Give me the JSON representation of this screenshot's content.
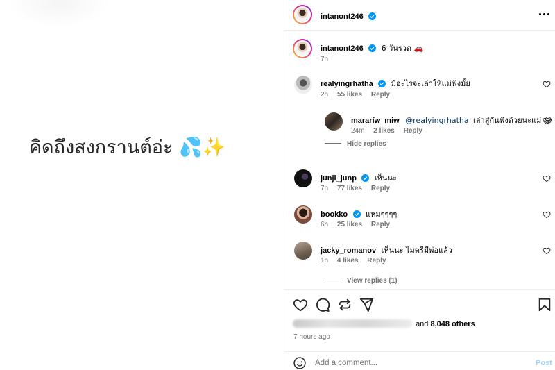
{
  "left": {
    "caption": "คิดถึงสงกรานต์อ่ะ 💦✨"
  },
  "header": {
    "username": "intanont246"
  },
  "post": {
    "username": "intanont246",
    "caption": "6 วันรวด 🚗",
    "time": "7h"
  },
  "comments": [
    {
      "username": "realyingrhatha",
      "verified": true,
      "text": "มีอะไรจะเล่าให้แม่ฟังมั้ย",
      "time": "2h",
      "likes": "55 likes",
      "reply": "Reply"
    },
    {
      "username": "mararíw_miw",
      "verified": false,
      "mention": "@realyingrhatha",
      "text": "เล่าสู่กันฟังด้วยนะแม่ 😂",
      "time": "24m",
      "likes": "2 likes",
      "reply": "Reply"
    },
    {
      "username": "junji_junp",
      "verified": true,
      "text": "เห็นนะ",
      "time": "7h",
      "likes": "77 likes",
      "reply": "Reply"
    },
    {
      "username": "bookko",
      "verified": true,
      "text": "แหมๆๆๆๆ",
      "time": "6h",
      "likes": "25 likes",
      "reply": "Reply"
    },
    {
      "username": "jacky_romanov",
      "verified": false,
      "text": "เห็นนะ ไมตรีมีพ่อแล้ว",
      "time": "1h",
      "likes": "4 likes",
      "reply": "Reply"
    }
  ],
  "replies_toggle": {
    "hide": "Hide replies",
    "view": "View replies (1)"
  },
  "footer": {
    "likes_suffix": "and",
    "likes_count": "8,048 others",
    "timestamp": "7 hours ago",
    "comment_placeholder": "Add a comment...",
    "post_label": "Post"
  },
  "colors": {
    "verified": "#0095f6",
    "secondary": "#737373",
    "post_disabled": "#a8d4fb"
  },
  "icons": [
    "heart-icon",
    "comment-icon",
    "share-icon",
    "send-icon",
    "bookmark-icon",
    "emoji-icon",
    "more-icon",
    "verified-icon"
  ]
}
